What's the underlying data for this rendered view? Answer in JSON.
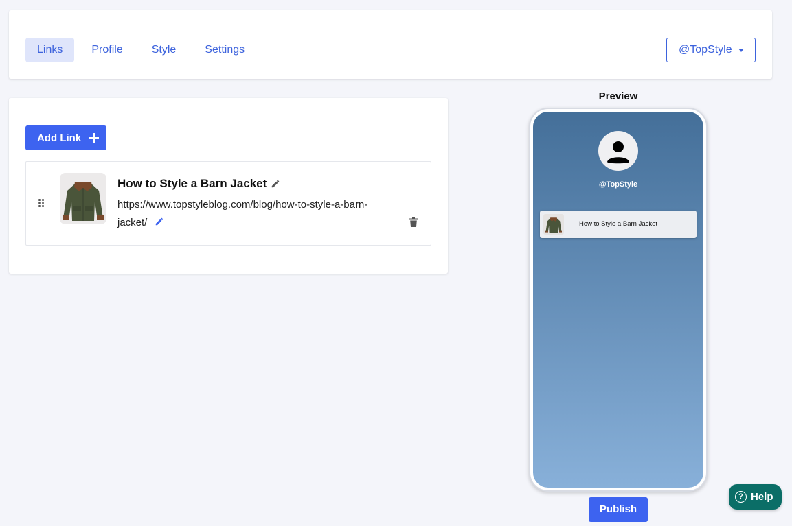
{
  "nav": {
    "tabs": [
      {
        "label": "Links",
        "active": true
      },
      {
        "label": "Profile",
        "active": false
      },
      {
        "label": "Style",
        "active": false
      },
      {
        "label": "Settings",
        "active": false
      }
    ],
    "account_select": {
      "value": "@TopStyle"
    }
  },
  "editor": {
    "add_link_label": "Add Link",
    "links": [
      {
        "title": "How to Style a Barn Jacket",
        "url": "https://www.topstyleblog.com/blog/how-to-style-a-barn-jacket/",
        "thumbnail": "barn-jacket-image"
      }
    ]
  },
  "preview": {
    "label": "Preview",
    "handle": "@TopStyle",
    "links": [
      {
        "title": "How to Style a Barn Jacket"
      }
    ]
  },
  "publish_label": "Publish",
  "help_label": "Help",
  "help_icon_glyph": "?",
  "colors": {
    "accent": "#3d63f0",
    "tab_active_bg": "#dfe5fb",
    "help": "#0b6e67",
    "phone_gradient_top": "#446f99",
    "phone_gradient_bottom": "#88b0d9",
    "page_bg": "#f4f5fa"
  }
}
